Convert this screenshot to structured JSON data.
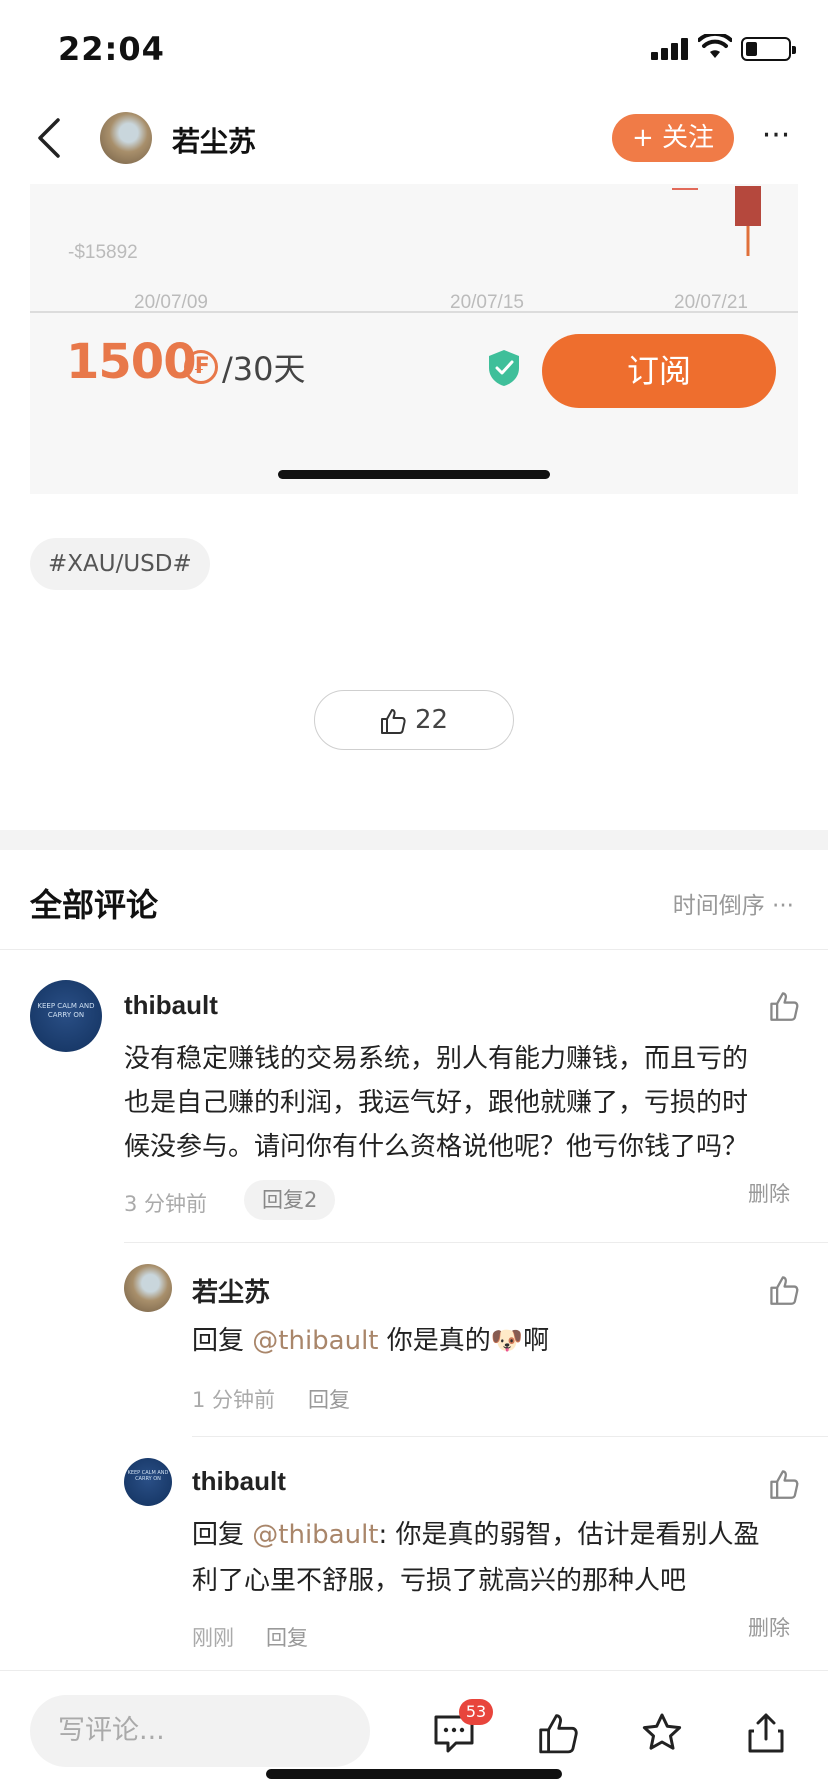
{
  "status_bar": {
    "time": "22:04"
  },
  "nav": {
    "author_name": "若尘苏",
    "follow_label": "+ 关注",
    "more_label": "···"
  },
  "chart_data": {
    "type": "candlestick",
    "y_tick_labels": [
      "-$15892"
    ],
    "x_tick_labels": [
      "20/07/09",
      "20/07/15",
      "20/07/21"
    ]
  },
  "price": {
    "amount": "1500",
    "coin_symbol": "₣",
    "period": "/30天",
    "subscribe_label": "订阅"
  },
  "tag": "#XAU/USD#",
  "like": {
    "count": "22"
  },
  "comments_header": {
    "title": "全部评论",
    "sort_label": "时间倒序 ···"
  },
  "comments": [
    {
      "user": "thibault",
      "avatar_text": "KEEP CALM AND CARRY ON",
      "lines": [
        "没有稳定赚钱的交易系统，别人有能力赚钱，而且亏的",
        "也是自己赚的利润，我运气好，跟他就赚了，亏损的时",
        "候没参与。请问你有什么资格说他呢？他亏你钱了吗？"
      ],
      "time": "3 分钟前",
      "reply_label": "回复2",
      "delete_label": "删除"
    }
  ],
  "replies": [
    {
      "user": "若尘苏",
      "prefix": "回复 ",
      "mention": "@thibault",
      "text": " 你是真的🐶啊",
      "time": "1 分钟前",
      "reply_label": "回复"
    },
    {
      "user": "thibault",
      "avatar_text": "KEEP CALM AND CARRY ON",
      "prefix": "回复 ",
      "mention": "@thibault",
      "text_line1": ": 你是真的弱智，估计是看别人盈",
      "text_line2": "利了心里不舒服，亏损了就高兴的那种人吧",
      "time": "刚刚",
      "reply_label": "回复",
      "delete_label": "删除"
    }
  ],
  "bottom_bar": {
    "compose_placeholder": "写评论...",
    "comment_badge": "53"
  },
  "colors": {
    "accent": "#ee6e2e",
    "price": "#e8784a",
    "mention": "#a9866a",
    "candle": "#b5483d"
  }
}
